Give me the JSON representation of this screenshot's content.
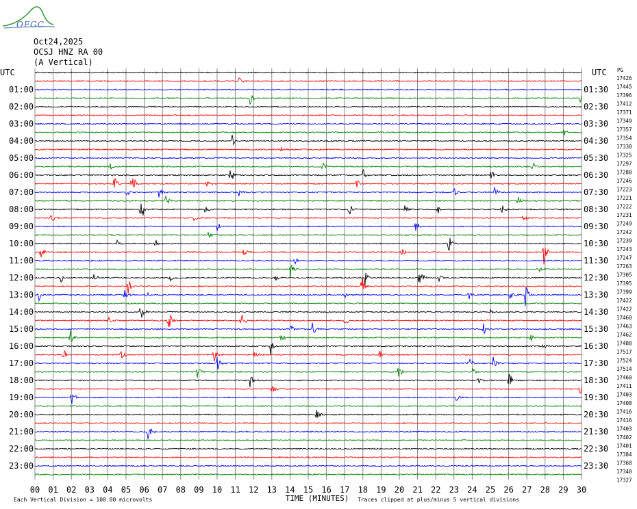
{
  "logo": {
    "text": "OFGC",
    "icon": "mountain-logo-icon"
  },
  "header": {
    "date": "Oct24,2025",
    "station": "OCSJ HNZ RA 00",
    "component": "(A Vertical)"
  },
  "chart_data": {
    "type": "line",
    "title": "OCSJ HNZ RA 00",
    "xlabel": "TIME (MINUTES)",
    "utc_label_left": "UTC",
    "utc_label_right": "UTC",
    "right_header": "PG",
    "xlim": [
      0,
      30
    ],
    "x_ticks": [
      "00",
      "01",
      "02",
      "03",
      "04",
      "05",
      "06",
      "07",
      "08",
      "09",
      "10",
      "11",
      "12",
      "13",
      "14",
      "15",
      "16",
      "17",
      "18",
      "19",
      "20",
      "21",
      "22",
      "23",
      "24",
      "25",
      "26",
      "27",
      "28",
      "29",
      "30"
    ],
    "trace_colors": [
      "#000000",
      "#ff0000",
      "#0000ff",
      "#008000"
    ],
    "left_hour_labels": [
      "01:00",
      "02:00",
      "03:00",
      "04:00",
      "05:00",
      "06:00",
      "07:00",
      "08:00",
      "09:00",
      "10:00",
      "11:00",
      "12:00",
      "13:00",
      "14:00",
      "15:00",
      "16:00",
      "17:00",
      "18:00",
      "19:00",
      "20:00",
      "21:00",
      "22:00",
      "23:00"
    ],
    "right_hour_labels": [
      "01:30",
      "02:30",
      "03:30",
      "04:30",
      "05:30",
      "06:30",
      "07:30",
      "08:30",
      "09:30",
      "10:30",
      "11:30",
      "12:30",
      "13:30",
      "14:30",
      "15:30",
      "16:30",
      "17:30",
      "18:30",
      "19:30",
      "20:30",
      "21:30",
      "22:30",
      "23:30"
    ],
    "trace_values": [
      "17426",
      "17445",
      "17396",
      "17412",
      "17371",
      "17349",
      "17357",
      "17354",
      "17338",
      "17325",
      "17297",
      "17280",
      "17246",
      "17223",
      "17221",
      "17222",
      "17231",
      "17249",
      "17242",
      "17239",
      "17243",
      "17247",
      "17263",
      "17305",
      "17395",
      "17399",
      "17422",
      "17422",
      "17460",
      "17463",
      "17462",
      "17488",
      "17517",
      "17524",
      "17514",
      "17460",
      "17411",
      "17403",
      "17408",
      "17416",
      "17416",
      "17403",
      "17402",
      "17401",
      "17384",
      "17368",
      "17340",
      "17327"
    ],
    "events": [
      {
        "trace": 1,
        "minute": 11.2,
        "amp": 0.25
      },
      {
        "trace": 3,
        "minute": 11.8,
        "amp": 0.45
      },
      {
        "trace": 3,
        "minute": 29.9,
        "amp": 0.5
      },
      {
        "trace": 7,
        "minute": 29.0,
        "amp": 0.4
      },
      {
        "trace": 8,
        "minute": 10.8,
        "amp": 0.55
      },
      {
        "trace": 9,
        "minute": 13.5,
        "amp": 0.2
      },
      {
        "trace": 11,
        "minute": 4.1,
        "amp": 0.35
      },
      {
        "trace": 11,
        "minute": 15.8,
        "amp": 0.4
      },
      {
        "trace": 11,
        "minute": 27.3,
        "amp": 0.35
      },
      {
        "trace": 12,
        "minute": 10.7,
        "amp": 0.9
      },
      {
        "trace": 12,
        "minute": 18.0,
        "amp": 0.45
      },
      {
        "trace": 12,
        "minute": 25.0,
        "amp": 0.6
      },
      {
        "trace": 13,
        "minute": 4.3,
        "amp": 0.9
      },
      {
        "trace": 13,
        "minute": 5.3,
        "amp": 0.9
      },
      {
        "trace": 13,
        "minute": 9.4,
        "amp": 0.35
      },
      {
        "trace": 13,
        "minute": 17.6,
        "amp": 0.5
      },
      {
        "trace": 14,
        "minute": 5.0,
        "amp": 0.45
      },
      {
        "trace": 14,
        "minute": 6.8,
        "amp": 0.45
      },
      {
        "trace": 14,
        "minute": 11.2,
        "amp": 0.35
      },
      {
        "trace": 14,
        "minute": 23.0,
        "amp": 0.35
      },
      {
        "trace": 14,
        "minute": 25.2,
        "amp": 0.4
      },
      {
        "trace": 15,
        "minute": 7.1,
        "amp": 0.6
      },
      {
        "trace": 15,
        "minute": 26.5,
        "amp": 0.4
      },
      {
        "trace": 16,
        "minute": 5.8,
        "amp": 1.0
      },
      {
        "trace": 16,
        "minute": 9.3,
        "amp": 0.45
      },
      {
        "trace": 16,
        "minute": 17.2,
        "amp": 0.9
      },
      {
        "trace": 16,
        "minute": 20.3,
        "amp": 0.3
      },
      {
        "trace": 16,
        "minute": 22.1,
        "amp": 0.4
      },
      {
        "trace": 16,
        "minute": 25.6,
        "amp": 0.45
      },
      {
        "trace": 17,
        "minute": 0.9,
        "amp": 0.45
      },
      {
        "trace": 17,
        "minute": 8.7,
        "amp": 0.3
      },
      {
        "trace": 17,
        "minute": 26.8,
        "amp": 0.4
      },
      {
        "trace": 18,
        "minute": 10.0,
        "amp": 0.35
      },
      {
        "trace": 18,
        "minute": 20.9,
        "amp": 0.7
      },
      {
        "trace": 19,
        "minute": 9.5,
        "amp": 0.3
      },
      {
        "trace": 20,
        "minute": 4.5,
        "amp": 0.25
      },
      {
        "trace": 20,
        "minute": 6.6,
        "amp": 0.35
      },
      {
        "trace": 20,
        "minute": 22.7,
        "amp": 0.8
      },
      {
        "trace": 21,
        "minute": 0.3,
        "amp": 0.6
      },
      {
        "trace": 21,
        "minute": 11.4,
        "amp": 0.4
      },
      {
        "trace": 21,
        "minute": 20.1,
        "amp": 0.4
      },
      {
        "trace": 21,
        "minute": 27.9,
        "amp": 1.0
      },
      {
        "trace": 22,
        "minute": 14.2,
        "amp": 0.35
      },
      {
        "trace": 23,
        "minute": 14.0,
        "amp": 0.6
      },
      {
        "trace": 23,
        "minute": 27.6,
        "amp": 0.3
      },
      {
        "trace": 24,
        "minute": 1.4,
        "amp": 0.4
      },
      {
        "trace": 24,
        "minute": 3.2,
        "amp": 0.35
      },
      {
        "trace": 24,
        "minute": 7.4,
        "amp": 0.35
      },
      {
        "trace": 24,
        "minute": 13.2,
        "amp": 0.3
      },
      {
        "trace": 24,
        "minute": 18.1,
        "amp": 0.7
      },
      {
        "trace": 24,
        "minute": 21.1,
        "amp": 0.9
      },
      {
        "trace": 24,
        "minute": 22.1,
        "amp": 0.6
      },
      {
        "trace": 25,
        "minute": 5.1,
        "amp": 0.6
      },
      {
        "trace": 25,
        "minute": 17.9,
        "amp": 1.0
      },
      {
        "trace": 26,
        "minute": 0.2,
        "amp": 0.5
      },
      {
        "trace": 26,
        "minute": 4.9,
        "amp": 0.5
      },
      {
        "trace": 26,
        "minute": 6.1,
        "amp": 0.3
      },
      {
        "trace": 26,
        "minute": 17.0,
        "amp": 0.25
      },
      {
        "trace": 26,
        "minute": 23.8,
        "amp": 0.4
      },
      {
        "trace": 26,
        "minute": 26.1,
        "amp": 0.7
      },
      {
        "trace": 26,
        "minute": 26.9,
        "amp": 1.0
      },
      {
        "trace": 28,
        "minute": 5.8,
        "amp": 1.0
      },
      {
        "trace": 28,
        "minute": 25.0,
        "amp": 0.3
      },
      {
        "trace": 29,
        "minute": 4.0,
        "amp": 0.4
      },
      {
        "trace": 29,
        "minute": 7.3,
        "amp": 1.0
      },
      {
        "trace": 29,
        "minute": 11.3,
        "amp": 0.6
      },
      {
        "trace": 29,
        "minute": 17.0,
        "amp": 0.5
      },
      {
        "trace": 30,
        "minute": 14.0,
        "amp": 0.5
      },
      {
        "trace": 30,
        "minute": 15.2,
        "amp": 0.6
      },
      {
        "trace": 30,
        "minute": 24.6,
        "amp": 0.5
      },
      {
        "trace": 31,
        "minute": 1.9,
        "amp": 0.8
      },
      {
        "trace": 31,
        "minute": 13.4,
        "amp": 0.5
      },
      {
        "trace": 31,
        "minute": 27.2,
        "amp": 0.4
      },
      {
        "trace": 32,
        "minute": 12.9,
        "amp": 0.7
      },
      {
        "trace": 32,
        "minute": 27.9,
        "amp": 0.3
      },
      {
        "trace": 33,
        "minute": 1.5,
        "amp": 0.6
      },
      {
        "trace": 33,
        "minute": 4.7,
        "amp": 0.6
      },
      {
        "trace": 33,
        "minute": 9.8,
        "amp": 0.7
      },
      {
        "trace": 33,
        "minute": 12.0,
        "amp": 0.6
      },
      {
        "trace": 33,
        "minute": 18.9,
        "amp": 0.4
      },
      {
        "trace": 34,
        "minute": 10.0,
        "amp": 0.6
      },
      {
        "trace": 34,
        "minute": 23.8,
        "amp": 0.5
      },
      {
        "trace": 34,
        "minute": 25.1,
        "amp": 0.6
      },
      {
        "trace": 35,
        "minute": 8.9,
        "amp": 0.5
      },
      {
        "trace": 35,
        "minute": 19.9,
        "amp": 0.6
      },
      {
        "trace": 35,
        "minute": 24.0,
        "amp": 0.35
      },
      {
        "trace": 36,
        "minute": 11.8,
        "amp": 0.5
      },
      {
        "trace": 36,
        "minute": 24.3,
        "amp": 0.3
      },
      {
        "trace": 36,
        "minute": 26.0,
        "amp": 0.8
      },
      {
        "trace": 37,
        "minute": 13.0,
        "amp": 0.4
      },
      {
        "trace": 37,
        "minute": 29.9,
        "amp": 0.4
      },
      {
        "trace": 38,
        "minute": 2.0,
        "amp": 0.5
      },
      {
        "trace": 38,
        "minute": 23.1,
        "amp": 0.4
      },
      {
        "trace": 40,
        "minute": 15.4,
        "amp": 0.6
      },
      {
        "trace": 42,
        "minute": 6.2,
        "amp": 0.8
      }
    ],
    "footer_left": "Each Vertical Division =  100.00 microvolts",
    "footer_right": "Traces clipped at plus/minus 5 vertical divisions"
  }
}
